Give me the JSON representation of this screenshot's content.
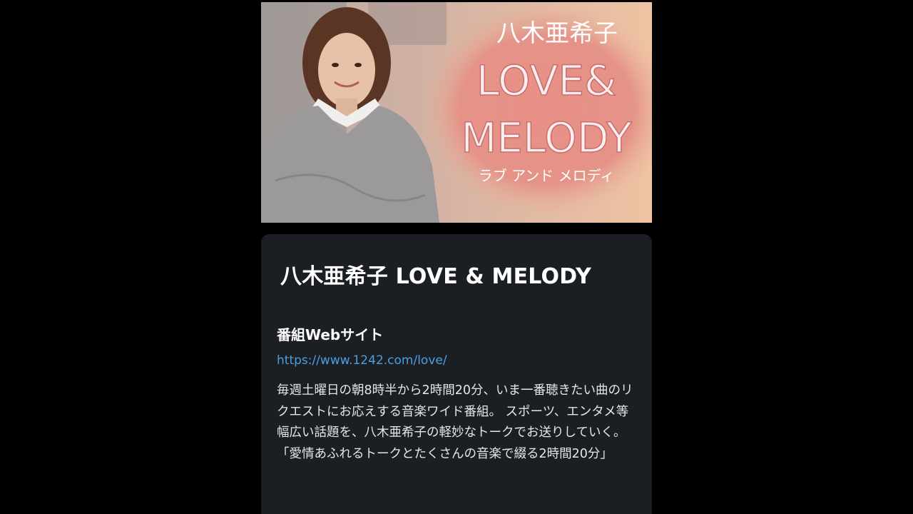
{
  "banner": {
    "logo_line1": "八木亜希子",
    "logo_line2": "LOVE&",
    "logo_line3": "MELODY",
    "logo_line4": "ラブ アンド メロディ"
  },
  "program": {
    "title": "八木亜希子 LOVE & MELODY",
    "website_heading": "番組Webサイト",
    "website_url": "https://www.1242.com/love/",
    "description": "毎週土曜日の朝8時半から2時間20分、いま一番聴きたい曲のリクエストにお応えする音楽ワイド番組。 スポーツ、エンタメ等幅広い話題を、八木亜希子の軽妙なトークでお送りしていく。 「愛情あふれるトークとたくさんの音楽で綴る2時間20分」"
  },
  "colors": {
    "background": "#000000",
    "card": "#1b1e22",
    "link": "#4a9fe0",
    "text": "#e6e6e6"
  }
}
